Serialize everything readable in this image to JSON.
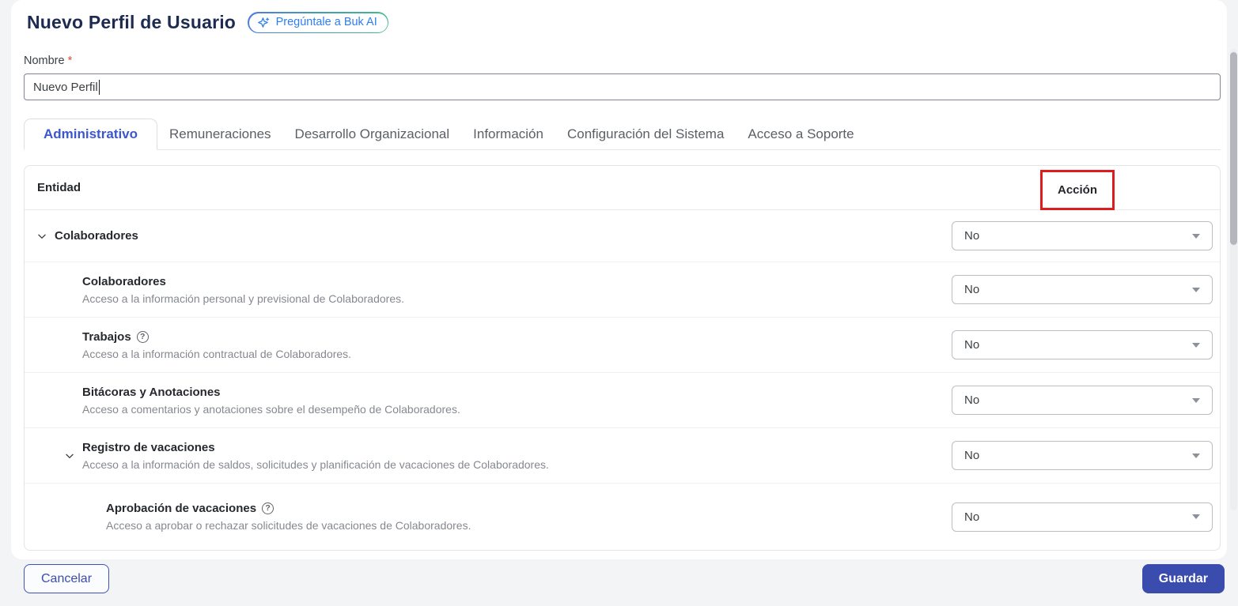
{
  "page": {
    "title": "Nuevo Perfil de Usuario",
    "ai_badge_label": "Pregúntale a Buk AI"
  },
  "form": {
    "nombre_label": "Nombre",
    "required_marker": "*",
    "nombre_value": "Nuevo Perfil"
  },
  "tabs": [
    {
      "label": "Administrativo",
      "active": true
    },
    {
      "label": "Remuneraciones",
      "active": false
    },
    {
      "label": "Desarrollo Organizacional",
      "active": false
    },
    {
      "label": "Información",
      "active": false
    },
    {
      "label": "Configuración del Sistema",
      "active": false
    },
    {
      "label": "Acceso a Soporte",
      "active": false
    }
  ],
  "table": {
    "entity_header": "Entidad",
    "action_header": "Acción",
    "rows": [
      {
        "title": "Colaboradores",
        "description": "",
        "level": 0,
        "expandable": true,
        "help": false,
        "action": "No"
      },
      {
        "title": "Colaboradores",
        "description": "Acceso a la información personal y previsional de Colaboradores.",
        "level": 1,
        "expandable": false,
        "help": false,
        "action": "No"
      },
      {
        "title": "Trabajos",
        "description": "Acceso a la información contractual de Colaboradores.",
        "level": 1,
        "expandable": false,
        "help": true,
        "action": "No"
      },
      {
        "title": "Bitácoras y Anotaciones",
        "description": "Acceso a comentarios y anotaciones sobre el desempeño de Colaboradores.",
        "level": 1,
        "expandable": false,
        "help": false,
        "action": "No"
      },
      {
        "title": "Registro de vacaciones",
        "description": "Acceso a la información de saldos, solicitudes y planificación de vacaciones de Colaboradores.",
        "level": 1,
        "expandable": true,
        "help": false,
        "action": "No"
      },
      {
        "title": "Aprobación de vacaciones",
        "description": "Acceso a aprobar o rechazar solicitudes de vacaciones de Colaboradores.",
        "level": 2,
        "expandable": false,
        "help": true,
        "action": "No"
      }
    ]
  },
  "footer": {
    "cancel_label": "Cancelar",
    "save_label": "Guardar"
  },
  "colors": {
    "accent_indigo": "#3a4cae",
    "active_tab_blue": "#3b57d0",
    "title_navy": "#1d2b50",
    "highlight_red": "#dd1d1d",
    "ai_gradient_start": "#4a7de0",
    "ai_gradient_end": "#3fbd8a",
    "ai_text_blue": "#2e7ef0"
  }
}
